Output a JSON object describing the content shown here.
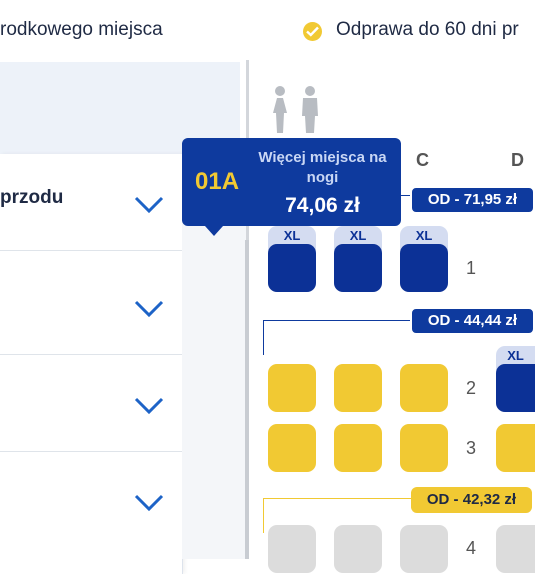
{
  "header": {
    "left_text": "rodkowego miejsca",
    "right_text": "Odprawa do 60 dni pr"
  },
  "accordion": {
    "items": [
      {
        "label": "przodu"
      },
      {
        "label": ""
      },
      {
        "label": ""
      },
      {
        "label": ""
      }
    ]
  },
  "seat_map": {
    "columns": [
      "C",
      "D"
    ],
    "rows": [
      "1",
      "2",
      "3",
      "4"
    ],
    "xl_label": "XL",
    "zones": [
      {
        "price": "OD  - 71,95 zł",
        "color": "#0e3a9e"
      },
      {
        "price": "OD  - 44,44 zł",
        "color": "#0e3a9e"
      },
      {
        "price": "OD  - 42,32 zł",
        "color": "#f1c933"
      }
    ]
  },
  "tooltip": {
    "seat_code": "01A",
    "title": "Więcej miejsca na nogi",
    "price": "74,06 zł"
  },
  "colors": {
    "brand_blue": "#0e3a9e",
    "seat_blue": "#0c3196",
    "seat_yellow": "#f1c933",
    "seat_grey": "#dcdcdc"
  }
}
